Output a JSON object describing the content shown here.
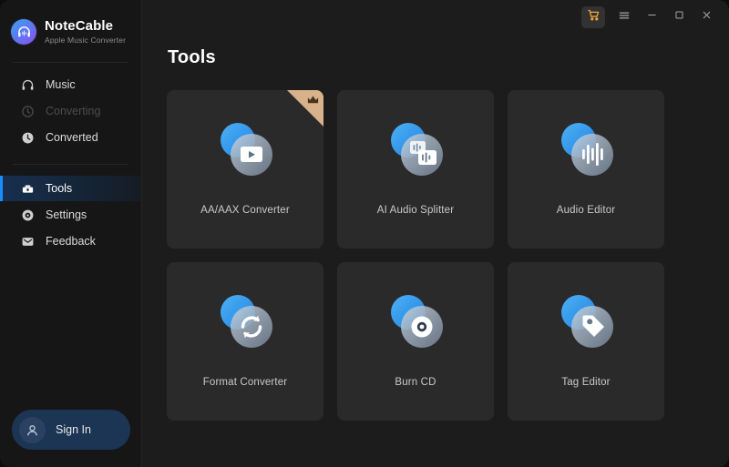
{
  "app": {
    "brand_name": "NoteCable",
    "brand_subtitle": "Apple Music Converter",
    "logo_icon": "headphone-waveform-logo",
    "accent_color": "#1a8cff",
    "window_bg": "#1c1c1c",
    "sidebar_bg": "#161616",
    "card_bg": "#2a2a2a"
  },
  "titlebar": {
    "cart_label": "cart-icon",
    "menu_label": "menu-icon",
    "minimize_label": "minimize-icon",
    "maximize_label": "maximize-icon",
    "close_label": "close-icon",
    "cart_color": "#f0a43c"
  },
  "sidebar": {
    "items": [
      {
        "label": "Music",
        "icon": "headphones-icon",
        "state": "normal"
      },
      {
        "label": "Converting",
        "icon": "sync-circle-icon",
        "state": "disabled"
      },
      {
        "label": "Converted",
        "icon": "clock-icon",
        "state": "normal"
      },
      {
        "label": "Tools",
        "icon": "toolbox-icon",
        "state": "active"
      },
      {
        "label": "Settings",
        "icon": "gear-icon",
        "state": "normal"
      },
      {
        "label": "Feedback",
        "icon": "message-icon",
        "state": "normal"
      }
    ],
    "signin": {
      "label": "Sign In",
      "icon": "user-avatar-icon"
    }
  },
  "main": {
    "title": "Tools",
    "tools": [
      {
        "label": "AA/AAX Converter",
        "icon": "play-window-icon",
        "premium": true,
        "ribbon_icon": "crown-icon"
      },
      {
        "label": "AI Audio Splitter",
        "icon": "split-waveform-icon",
        "premium": false,
        "ribbon_icon": ""
      },
      {
        "label": "Audio Editor",
        "icon": "waveform-bars-icon",
        "premium": false,
        "ribbon_icon": ""
      },
      {
        "label": "Format Converter",
        "icon": "refresh-arrows-icon",
        "premium": false,
        "ribbon_icon": ""
      },
      {
        "label": "Burn CD",
        "icon": "disc-icon",
        "premium": false,
        "ribbon_icon": ""
      },
      {
        "label": "Tag Editor",
        "icon": "price-tag-icon",
        "premium": false,
        "ribbon_icon": ""
      }
    ]
  }
}
